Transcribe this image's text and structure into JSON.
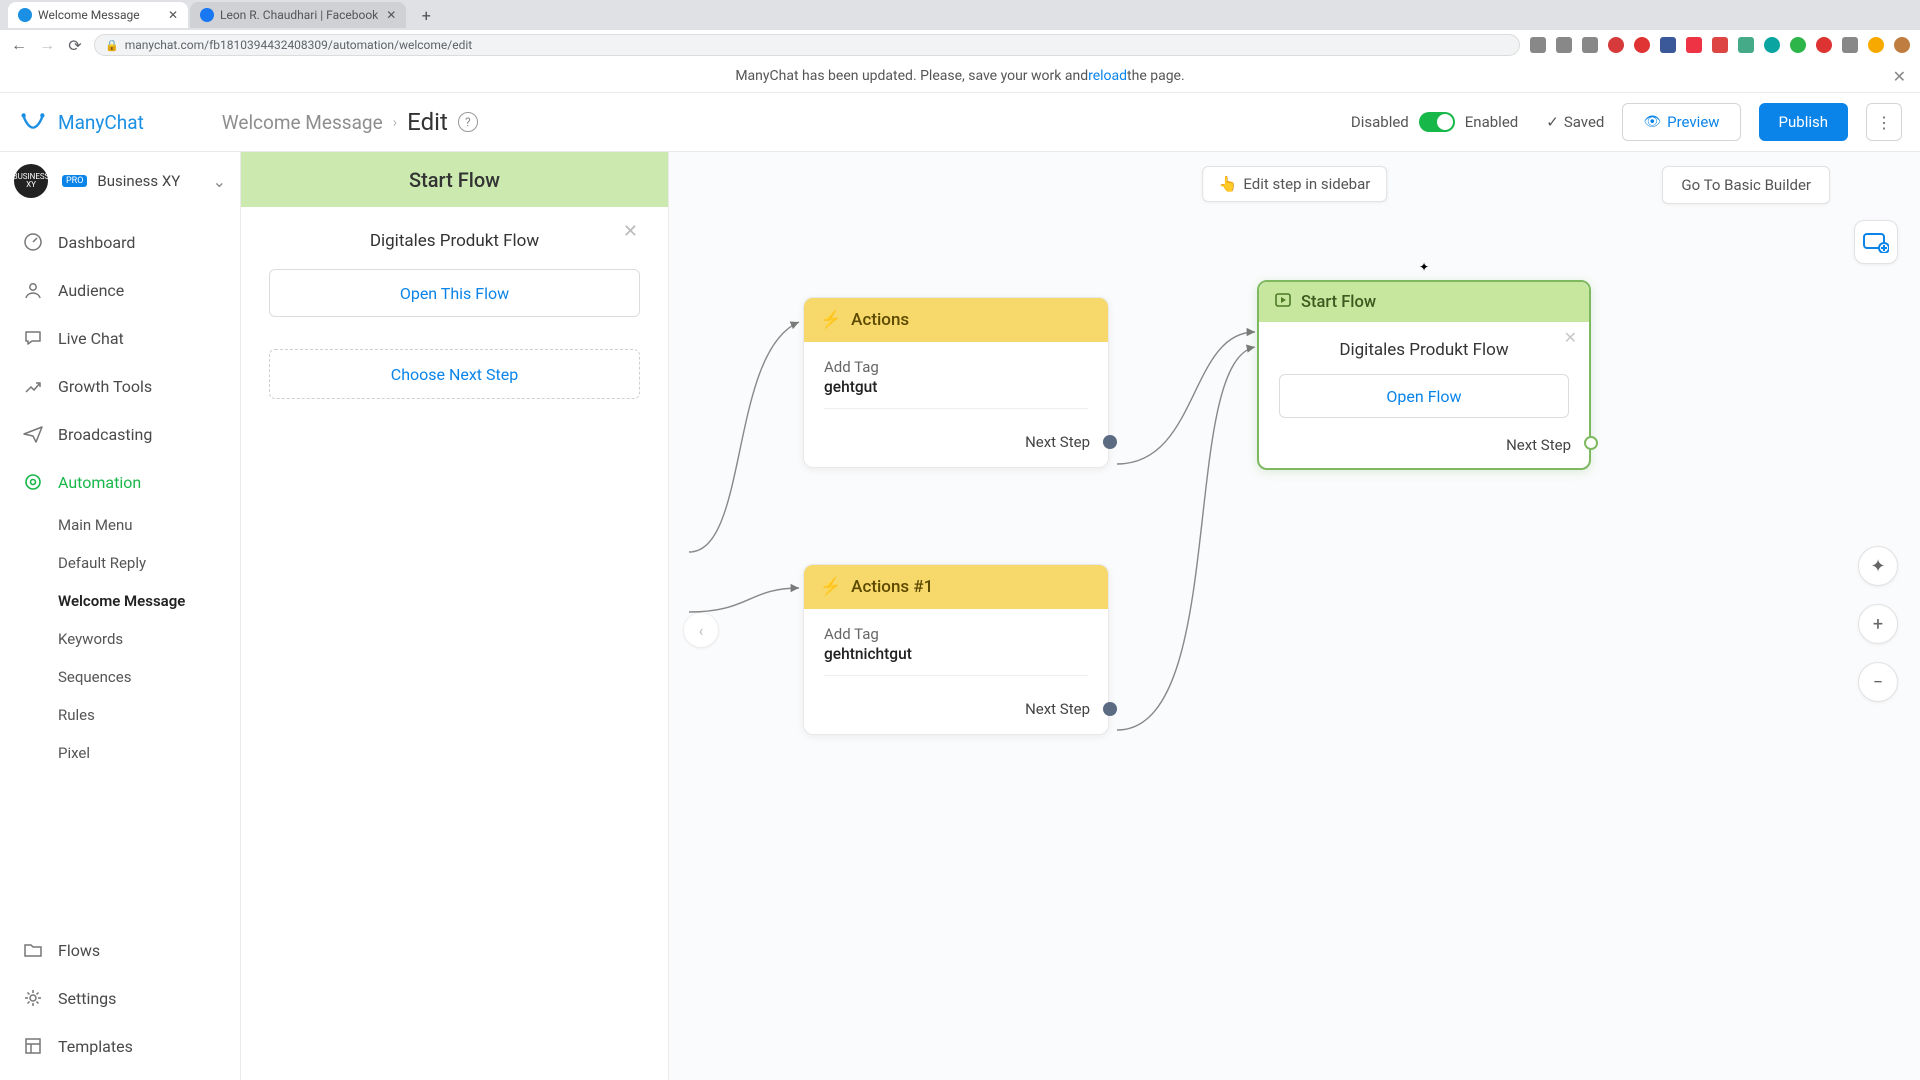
{
  "browser": {
    "tabs": [
      {
        "title": "Welcome Message"
      },
      {
        "title": "Leon R. Chaudhari | Facebook"
      }
    ],
    "url": "manychat.com/fb181039443240830​9/automation/welcome/edit"
  },
  "banner": {
    "prefix": "ManyChat has been updated. Please, save your work and ",
    "link": "reload",
    "suffix": " the page."
  },
  "header": {
    "brand": "ManyChat",
    "breadcrumb": "Welcome Message",
    "page": "Edit",
    "disabled_label": "Disabled",
    "enabled_label": "Enabled",
    "saved_label": "Saved",
    "preview": "Preview",
    "publish": "Publish"
  },
  "workspace": {
    "name": "Business XY",
    "badge": "PRO",
    "avatar_text": "BUSINESS XY"
  },
  "nav": {
    "dashboard": "Dashboard",
    "audience": "Audience",
    "livechat": "Live Chat",
    "growth": "Growth Tools",
    "broadcasting": "Broadcasting",
    "automation": "Automation",
    "flows": "Flows",
    "settings": "Settings",
    "templates": "Templates"
  },
  "subnav": {
    "main_menu": "Main Menu",
    "default_reply": "Default Reply",
    "welcome_message": "Welcome Message",
    "keywords": "Keywords",
    "sequences": "Sequences",
    "rules": "Rules",
    "pixel": "Pixel"
  },
  "panel": {
    "title": "Start Flow",
    "flow_name": "Digitales Produkt Flow",
    "open_flow_btn": "Open This Flow",
    "choose_next": "Choose Next Step"
  },
  "canvas": {
    "hint": "Edit step in sidebar",
    "go_basic": "Go To Basic Builder",
    "next_step": "Next Step",
    "nodes": {
      "actions1": {
        "title": "Actions",
        "field_label": "Add Tag",
        "field_value": "gehtgut"
      },
      "actions2": {
        "title": "Actions #1",
        "field_label": "Add Tag",
        "field_value": "gehtnichtgut"
      },
      "startflow": {
        "title": "Start Flow",
        "flow_name": "Digitales Produkt Flow",
        "open_btn": "Open Flow"
      }
    }
  }
}
